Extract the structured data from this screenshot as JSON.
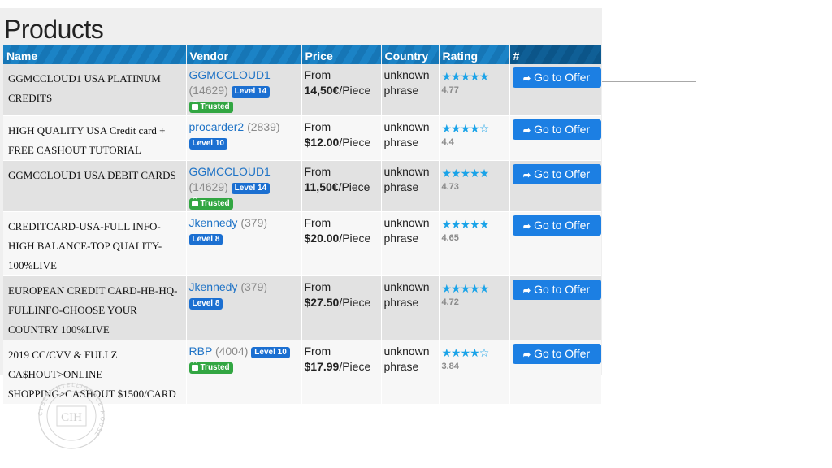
{
  "page": {
    "title": "Products"
  },
  "table": {
    "headers": [
      "Name",
      "Vendor",
      "Price",
      "Country",
      "Rating",
      "#"
    ],
    "rows": [
      {
        "name": "GGMCCLOUD1 USA PLATINUM CREDITS",
        "vendor": "GGMCCLOUD1",
        "vendor_count": "(14629)",
        "level": "Level 14",
        "trusted": "Trusted",
        "price_from": "From",
        "price_amount": "14,50€",
        "price_unit": "/Piece",
        "country": "unknown phrase",
        "stars": "★★★★★",
        "stars_empty": "",
        "rating": "4.77",
        "offer_label": "Go to Offer"
      },
      {
        "name": "HIGH QUALITY USA Credit card + FREE CASHOUT TUTORIAL",
        "vendor": "procarder2",
        "vendor_count": "(2839)",
        "level": "Level 10",
        "trusted": "",
        "price_from": "From",
        "price_amount": "$12.00",
        "price_unit": "/Piece",
        "country": "unknown phrase",
        "stars": "★★★★",
        "stars_empty": "☆",
        "rating": "4.4",
        "offer_label": "Go to Offer"
      },
      {
        "name": "GGMCCLOUD1 USA DEBIT CARDS",
        "vendor": "GGMCCLOUD1",
        "vendor_count": "(14629)",
        "level": "Level 14",
        "trusted": "Trusted",
        "price_from": "From",
        "price_amount": "11,50€",
        "price_unit": "/Piece",
        "country": "unknown phrase",
        "stars": "★★★★★",
        "stars_empty": "",
        "rating": "4.73",
        "offer_label": "Go to Offer"
      },
      {
        "name": "CREDITCARD-USA-FULL INFO-HIGH BALANCE-TOP QUALITY-100%LIVE",
        "vendor": "Jkennedy",
        "vendor_count": "(379)",
        "level": "Level 8",
        "trusted": "",
        "price_from": "From",
        "price_amount": "$20.00",
        "price_unit": "/Piece",
        "country": "unknown phrase",
        "stars": "★★★★★",
        "stars_empty": "",
        "rating": "4.65",
        "offer_label": "Go to Offer"
      },
      {
        "name": "EUROPEAN CREDIT CARD-HB-HQ-FULLINFO-CHOOSE YOUR COUNTRY 100%LIVE",
        "vendor": "Jkennedy",
        "vendor_count": "(379)",
        "level": "Level 8",
        "trusted": "",
        "price_from": "From",
        "price_amount": "$27.50",
        "price_unit": "/Piece",
        "country": "unknown phrase",
        "stars": "★★★★★",
        "stars_empty": "",
        "rating": "4.72",
        "offer_label": "Go to Offer"
      },
      {
        "name": "2019 CC/CVV & FULLZ CA$HOUT>ONLINE $HOPPING>CASHOUT $1500/CARD",
        "vendor": "RBP",
        "vendor_count": "(4004)",
        "level": "Level 10",
        "trusted": "Trusted",
        "price_from": "From",
        "price_amount": "$17.99",
        "price_unit": "/Piece",
        "country": "unknown phrase",
        "stars": "★★★★",
        "stars_empty": "☆",
        "rating": "3.84",
        "offer_label": "Go to Offer"
      }
    ]
  },
  "watermark": {
    "ring_text": "CYBER INTELLIGENCE HOUSE",
    "monogram": "CIH"
  },
  "colors": {
    "header_blue": "#1b83c6",
    "button_blue": "#1c7fe3",
    "star_blue": "#1aa3e8",
    "trusted_green": "#32a642",
    "level_blue": "#1b6fd1"
  }
}
